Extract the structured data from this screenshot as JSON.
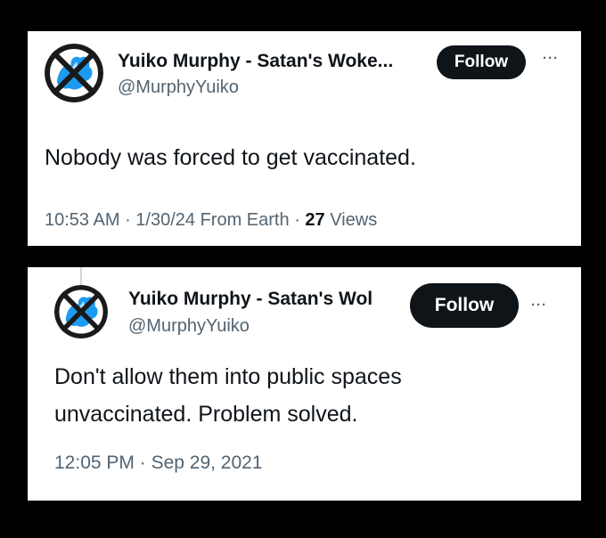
{
  "tweets": [
    {
      "name": "Yuiko Murphy - Satan's Woke...",
      "handle": "@MurphyYuiko",
      "follow_label": "Follow",
      "more_label": "···",
      "text_lines": [
        "Nobody was forced to get vaccinated."
      ],
      "meta": {
        "time": "10:53 AM",
        "date": "1/30/24",
        "source": "From Earth",
        "views_count": "27",
        "views_label": "Views"
      }
    },
    {
      "name": "Yuiko Murphy - Satan's Wol",
      "handle": "@MurphyYuiko",
      "follow_label": "Follow",
      "more_label": "···",
      "text_lines": [
        "Don't allow them into public spaces",
        "unvaccinated. Problem solved."
      ],
      "meta": {
        "time": "12:05 PM",
        "date": "Sep 29, 2021"
      }
    }
  ],
  "colors": {
    "background": "#000000",
    "card": "#ffffff",
    "text_primary": "#0f1419",
    "text_secondary": "#536471",
    "button_bg": "#0f1419",
    "avatar_blue": "#1d9bf0"
  },
  "icons": {
    "avatar": "crossed-out-blue-figure-avatar",
    "more": "ellipsis-icon"
  }
}
